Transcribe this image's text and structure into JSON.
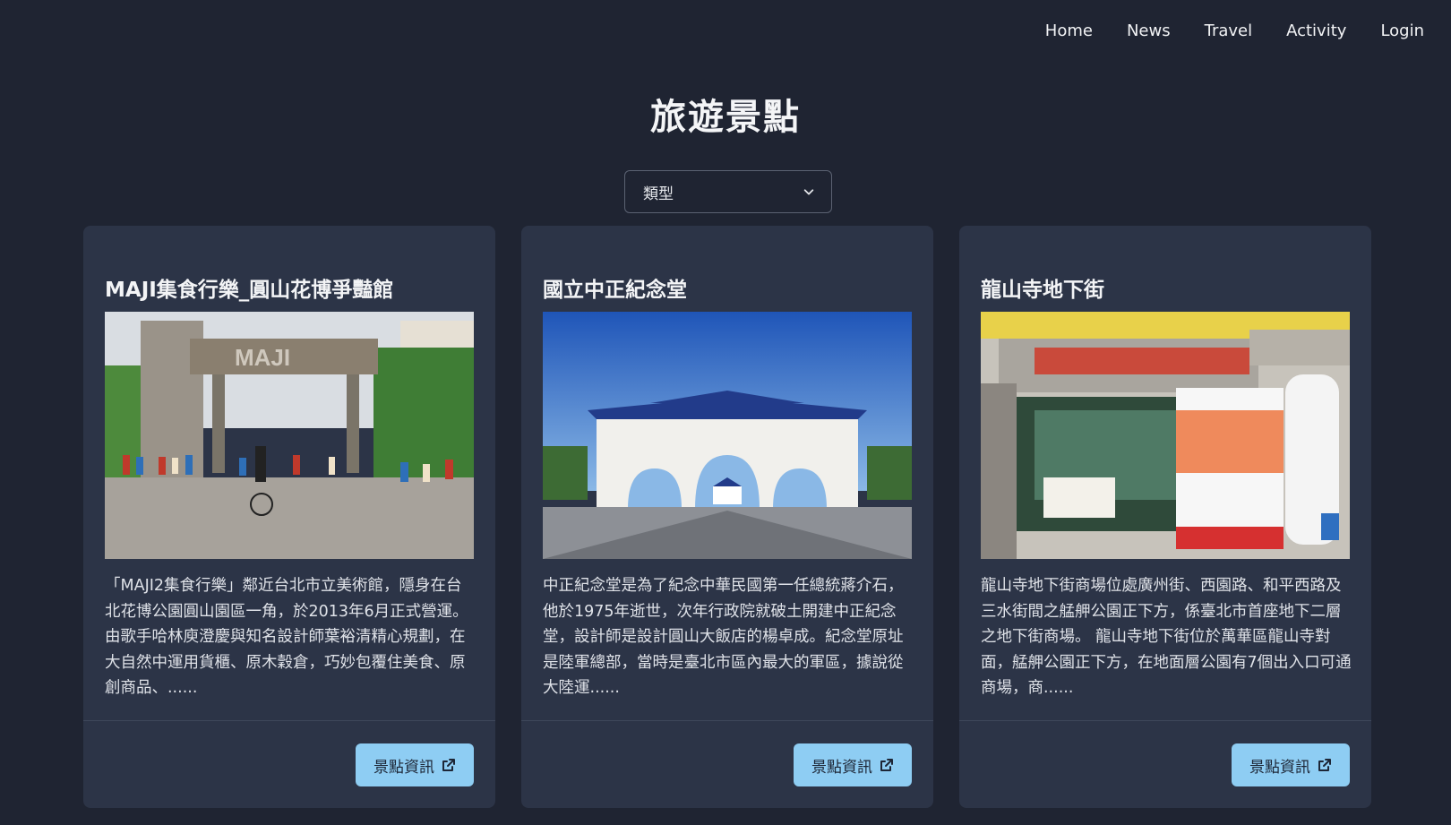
{
  "nav": {
    "items": [
      {
        "label": "Home"
      },
      {
        "label": "News"
      },
      {
        "label": "Travel"
      },
      {
        "label": "Activity"
      },
      {
        "label": "Login"
      }
    ]
  },
  "page": {
    "title": "旅遊景點"
  },
  "filter": {
    "selected": "類型",
    "icon": "chevron-down-icon"
  },
  "cards": [
    {
      "title": "MAJI集食行樂_圓山花博爭豔館",
      "image": "maji-market-photo",
      "description": "「MAJI2集食行樂」鄰近台北市立美術館，隱身在台北花博公園圓山園區一角，於2013年6月正式營運。由歌手哈林庾澄慶與知名設計師葉裕清精心規劃，在大自然中運用貨櫃、原木穀倉，巧妙包覆住美食、原創商品、......",
      "button": "景點資訊"
    },
    {
      "title": "國立中正紀念堂",
      "image": "memorial-hall-gate-photo",
      "description": "中正紀念堂是為了紀念中華民國第一任總統蔣介石，他於1975年逝世，次年行政院就破土開建中正紀念堂，設計師是設計圓山大飯店的楊卓成。紀念堂原址是陸軍總部，當時是臺北市區內最大的軍區，據說從大陸運......",
      "button": "景點資訊"
    },
    {
      "title": "龍山寺地下街",
      "image": "longshan-underground-mall-photo",
      "description": "龍山寺地下街商場位處廣州街、西園路、和平西路及三水街間之艋舺公園正下方，係臺北市首座地下二層之地下街商場。 龍山寺地下街位於萬華區龍山寺對面，艋舺公園正下方，在地面層公園有7個出入口可通商場，商......",
      "button": "景點資訊"
    }
  ],
  "colors": {
    "background": "#1f2432",
    "card": "#2c3447",
    "button": "#8ecdf3"
  }
}
